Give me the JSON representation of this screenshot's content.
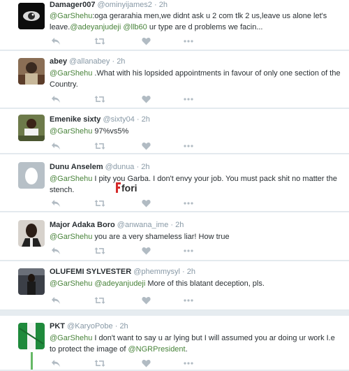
{
  "tweets": [
    {
      "name": "Damager007",
      "handle": "@ominyijames2",
      "time": "2h",
      "segments": [
        {
          "t": "m",
          "v": "@GarShehu"
        },
        {
          "t": "s",
          "v": ":oga gerarahia men,we didnt ask u 2 com tlk 2 us,leave us alone let's leave."
        },
        {
          "t": "m",
          "v": "@adeyanjudeji"
        },
        {
          "t": "s",
          "v": " "
        },
        {
          "t": "m",
          "v": "@llb60"
        },
        {
          "t": "s",
          "v": " ur type are d problems we facin..."
        }
      ]
    },
    {
      "name": "abey",
      "handle": "@allanabey",
      "time": "2h",
      "segments": [
        {
          "t": "m",
          "v": "@GarShehu"
        },
        {
          "t": "s",
          "v": " .What with his lopsided appointments in favour of only one section of the Country."
        }
      ]
    },
    {
      "name": "Emenike sixty",
      "handle": "@sixty04",
      "time": "2h",
      "segments": [
        {
          "t": "m",
          "v": "@GarShehu"
        },
        {
          "t": "s",
          "v": " 97%vs5%"
        }
      ]
    },
    {
      "name": "Dunu Anselem",
      "handle": "@dunua",
      "time": "2h",
      "segments": [
        {
          "t": "m",
          "v": "@GarShehu"
        },
        {
          "t": "s",
          "v": " I pity you Garba. I don't envy your job. You must pack shit no matter the stench."
        }
      ]
    },
    {
      "name": "Major Adaka Boro",
      "handle": "@anwana_ime",
      "time": "2h",
      "segments": [
        {
          "t": "m",
          "v": "@GarShehu"
        },
        {
          "t": "s",
          "v": " you are a very shameless liar! How true"
        }
      ]
    },
    {
      "name": "OLUFEMI SYLVESTER",
      "handle": "@phemmysyl",
      "time": "2h",
      "segments": [
        {
          "t": "m",
          "v": "@GarShehu"
        },
        {
          "t": "s",
          "v": " "
        },
        {
          "t": "m",
          "v": "@adeyanjudeji"
        },
        {
          "t": "s",
          "v": " More of this blatant deception, pls."
        }
      ]
    },
    {
      "name": "PKT",
      "handle": "@KaryoPobe",
      "time": "2h",
      "segments": [
        {
          "t": "m",
          "v": "@GarShehu"
        },
        {
          "t": "s",
          "v": " I don't want to say u ar lying but I will assumed you ar doing ur work I.e to protect the image of "
        },
        {
          "t": "m",
          "v": "@NGRPresident"
        },
        {
          "t": "s",
          "v": "."
        }
      ]
    }
  ],
  "watermark": "fori",
  "icons": {
    "reply": "reply-icon",
    "retweet": "retweet-icon",
    "like": "heart-icon",
    "more": "more-icon"
  },
  "colors": {
    "mention": "#48833a",
    "muted": "#8899a6",
    "icon": "#b1bbc3",
    "thread": "#66b866"
  }
}
